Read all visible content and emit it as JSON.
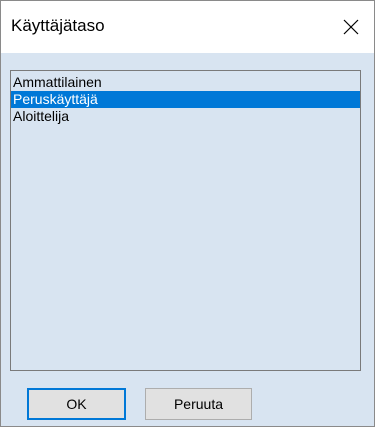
{
  "window": {
    "title": "Käyttäjätaso",
    "close_icon": "close-icon"
  },
  "list": {
    "items": [
      {
        "label": "Ammattilainen",
        "selected": false
      },
      {
        "label": "Peruskäyttäjä",
        "selected": true
      },
      {
        "label": "Aloittelija",
        "selected": false
      }
    ]
  },
  "buttons": {
    "ok_label": "OK",
    "cancel_label": "Peruuta"
  },
  "colors": {
    "background": "#d8e4f1",
    "selection": "#0078d7",
    "button_face": "#e1e1e1",
    "default_button_border": "#0078d7"
  }
}
